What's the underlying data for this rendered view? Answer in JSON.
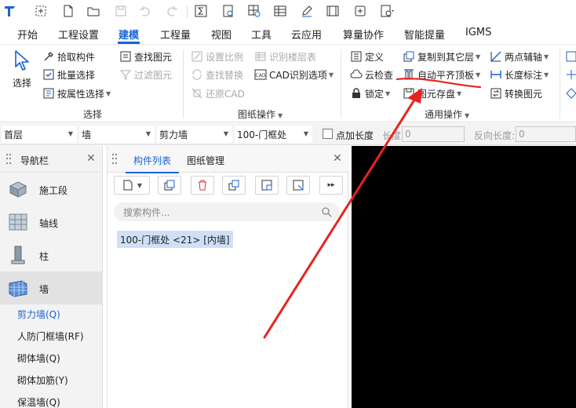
{
  "menu": {
    "tabs": [
      "开始",
      "工程设置",
      "建模",
      "工程量",
      "视图",
      "工具",
      "云应用",
      "算量协作",
      "智能提量",
      "IGMS"
    ],
    "active_index": 2
  },
  "ribbon": {
    "select_group": {
      "big_button": "选择",
      "pick": "拾取构件",
      "batch": "批量选择",
      "by_attr": "按属性选择",
      "find": "查找图元",
      "filter": "过滤图元",
      "title": "选择"
    },
    "drawing_group": {
      "set_scale": "设置比例",
      "find_replace": "查找替换",
      "restore_cad": "还原CAD",
      "identify_floor": "识别楼层表",
      "cad_options": "CAD识别选项",
      "title": "图纸操作"
    },
    "common_group": {
      "define": "定义",
      "cloud_check": "云检查",
      "lock": "锁定",
      "copy_to_floor": "复制到其它层",
      "auto_align_top": "自动平齐顶板",
      "save_element": "图元存盘",
      "two_point_axis": "两点辅轴",
      "length_dim": "长度标注",
      "convert_element": "转换图元",
      "title": "通用操作"
    }
  },
  "propbar": {
    "floor": "首层",
    "category": "墙",
    "type": "剪力墙",
    "component": "100-门框处",
    "point_length": "点加长度",
    "length_label": "长度:",
    "length_value": "0",
    "reverse_label": "反向长度:",
    "reverse_value": "0"
  },
  "nav": {
    "title": "导航栏",
    "items": [
      "施工段",
      "轴线",
      "柱",
      "墙"
    ],
    "active_index": 3,
    "subitems": [
      "剪力墙(Q)",
      "人防门框墙(RF)",
      "砌体墙(Q)",
      "砌体加筋(Y)",
      "保温墙(Q)"
    ],
    "active_sub_index": 0
  },
  "components": {
    "tabs": [
      "构件列表",
      "图纸管理"
    ],
    "active_tab": 0,
    "search_placeholder": "搜索构件...",
    "items": [
      "100-门框处 <21> [内墙]"
    ]
  },
  "colors": {
    "accent": "#1a62d6",
    "annotation": "#e8231f",
    "canvas": "#000000"
  }
}
